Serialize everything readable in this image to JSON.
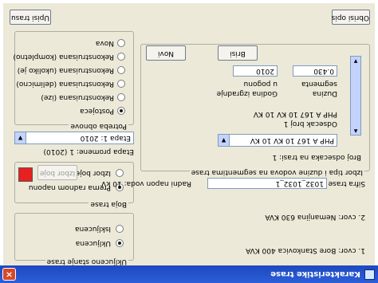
{
  "window": {
    "title": "Karakteristike trase"
  },
  "nodes": {
    "node1": "1. cvor: Bore Stankovica 400 KVA",
    "node2": "2. cvor: Nemanjina 630 KVA"
  },
  "trace": {
    "name_label": "Sifra trase",
    "name_value": "1032_1032_1",
    "voltage_label": "Radni napon voda: 10 kV",
    "conductors_group": "Izbor tipa i duzine vodova na segmentima trase"
  },
  "segments": {
    "count_label": "Broj odsecaka na trasi: 1",
    "type_value": "PHP A 167 10 KV 10 KV",
    "segment_type_label": "Odsecak broj 1",
    "segment_type_value": "PHP A 167 10 KV 10 KV",
    "length_label": "Duzina",
    "length_sublabel": "segmenta",
    "length_value": "0.430",
    "year_label": "Godina izgradnje",
    "year_sublabel": "u pogonu",
    "year_value": "2010"
  },
  "buttons": {
    "new": "Novi",
    "delete": "Brisi",
    "print": "Upisi trasu",
    "clear": "Obrisi opis"
  },
  "stage": {
    "combo_value": "Etapa 1: 2010",
    "changes_label": "Etapa promene: 1 (2010)",
    "group_title": "Potreba obnove",
    "options": [
      "Nova",
      "Rekonstruisana (kompletno)",
      "Rekonstruisana (ukoliko je)",
      "Rekonstruisana (delimicno)",
      "Rekonstruisana (ize)",
      "Postojeca"
    ],
    "selected_index": 5
  },
  "color": {
    "group_title": "Boja trase",
    "option_uniform": "Prema radnom naponu",
    "option_custom": "Izbor boje",
    "choose_button": "Izbor boje",
    "swatch": "#e8201f"
  },
  "status": {
    "group_title": "Ukljuceno stanje trase",
    "option_on": "Ukljucena",
    "option_off": "Iskljucena"
  }
}
